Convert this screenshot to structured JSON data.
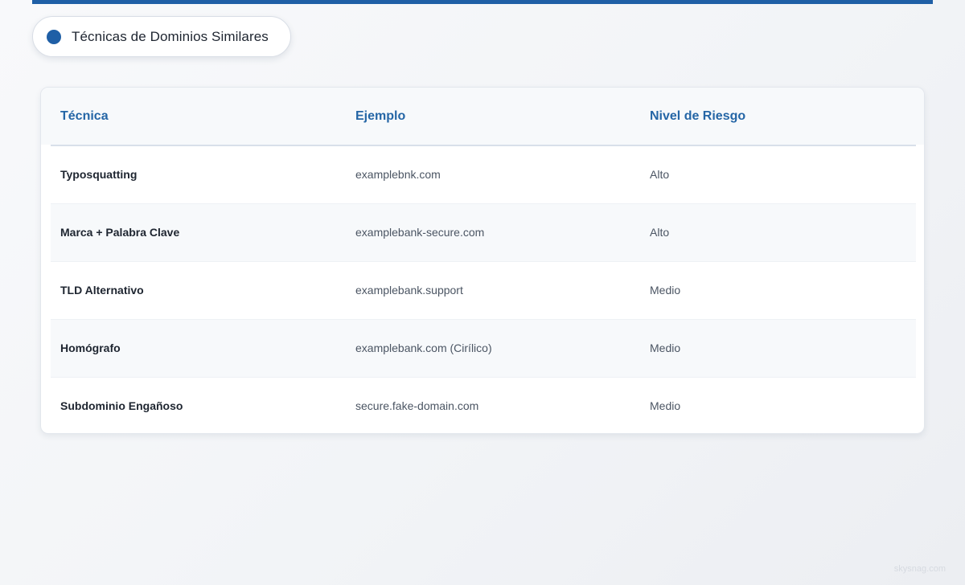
{
  "title": "Técnicas de Dominios Similares",
  "colors": {
    "accent": "#1f5fa6",
    "header_text": "#2566a6",
    "row_alt": "#f7f9fb"
  },
  "table": {
    "headers": [
      "Técnica",
      "Ejemplo",
      "Nivel de Riesgo"
    ],
    "rows": [
      {
        "technique": "Typosquatting",
        "example": "examplebnk.com",
        "risk": "Alto"
      },
      {
        "technique": "Marca + Palabra Clave",
        "example": "examplebank-secure.com",
        "risk": "Alto"
      },
      {
        "technique": "TLD Alternativo",
        "example": "examplebank.support",
        "risk": "Medio"
      },
      {
        "technique": "Homógrafo",
        "example": "examplebank.com (Cirílico)",
        "risk": "Medio"
      },
      {
        "technique": "Subdominio Engañoso",
        "example": "secure.fake-domain.com",
        "risk": "Medio"
      }
    ]
  },
  "watermark": "skysnag.com"
}
